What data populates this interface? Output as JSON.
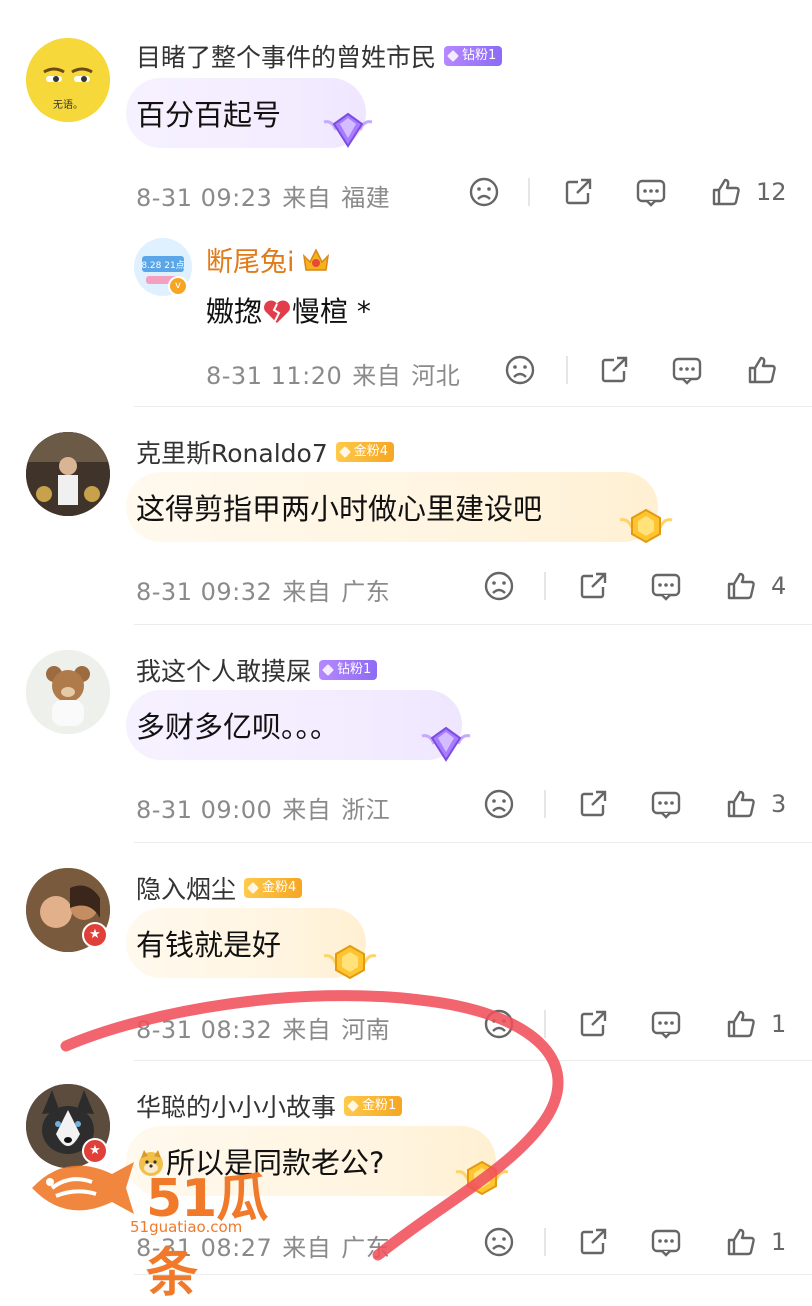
{
  "comments": [
    {
      "username": "目睹了整个事件的曾姓市民",
      "badge": "钻粉1",
      "badge_type": "diamond",
      "text": "百分百起号",
      "date": "8-31 09:23",
      "source": "来自",
      "location": "福建",
      "likes": "12",
      "avatar_text": "无语。"
    },
    {
      "username": "克里斯Ronaldo7",
      "badge": "金粉4",
      "badge_type": "gold",
      "text": "这得剪指甲两小时做心里建设吧",
      "date": "8-31 09:32",
      "source": "来自",
      "location": "广东",
      "likes": "4"
    },
    {
      "username": "我这个人敢摸屎",
      "badge": "钻粉1",
      "badge_type": "diamond",
      "text": "多财多亿呗。。。",
      "date": "8-31 09:00",
      "source": "来自",
      "location": "浙江",
      "likes": "3"
    },
    {
      "username": "隐入烟尘",
      "badge": "金粉4",
      "badge_type": "gold",
      "text": "有钱就是好",
      "date": "8-31 08:32",
      "source": "来自",
      "location": "河南",
      "likes": "1"
    },
    {
      "username": "华聪的小小小故事",
      "badge": "金粉1",
      "badge_type": "gold",
      "text": "所以是同款老公?",
      "date": "8-31 08:27",
      "source": "来自",
      "location": "广东",
      "likes": "1"
    }
  ],
  "reply": {
    "username": "断尾兔i",
    "text_a": "嫐揔",
    "text_b": "慢楦 *",
    "date": "8-31 11:20",
    "source": "来自",
    "location": "河北",
    "avatar_line1": "8.28 21点"
  },
  "watermark": {
    "brand": "51瓜条",
    "url": "51guatiao.com"
  },
  "colors": {
    "diamond": "#8d6bf5",
    "gold": "#f5a623",
    "annotation": "#f0505a",
    "watermark": "#f07a2a"
  }
}
